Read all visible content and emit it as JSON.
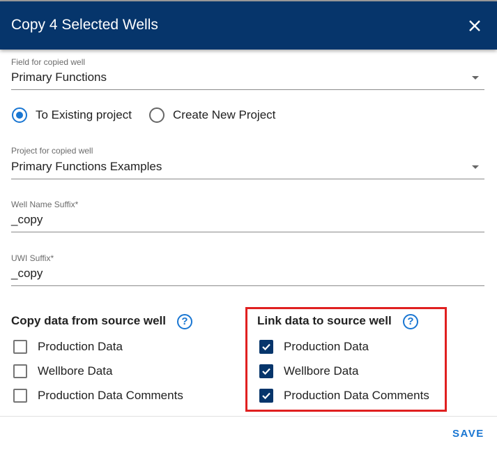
{
  "dialog": {
    "title": "Copy 4 Selected Wells",
    "close_icon": "close-icon"
  },
  "field_select": {
    "label": "Field for copied well",
    "value": "Primary Functions"
  },
  "destination": {
    "options": [
      {
        "label": "To Existing project",
        "selected": true
      },
      {
        "label": "Create New Project",
        "selected": false
      }
    ]
  },
  "project_select": {
    "label": "Project for copied well",
    "value": "Primary Functions Examples"
  },
  "well_name_suffix": {
    "label": "Well Name Suffix*",
    "value": "_copy"
  },
  "uwi_suffix": {
    "label": "UWI Suffix*",
    "value": "_copy"
  },
  "copy_section": {
    "title": "Copy data from source well",
    "help_icon": "help-circle-icon",
    "help_glyph": "?",
    "items": [
      {
        "label": "Production Data",
        "checked": false
      },
      {
        "label": "Wellbore Data",
        "checked": false
      },
      {
        "label": "Production Data Comments",
        "checked": false
      }
    ]
  },
  "link_section": {
    "title": "Link data to source well",
    "help_icon": "help-circle-icon",
    "help_glyph": "?",
    "items": [
      {
        "label": "Production Data",
        "checked": true
      },
      {
        "label": "Wellbore Data",
        "checked": true
      },
      {
        "label": "Production Data Comments",
        "checked": true
      }
    ]
  },
  "footer": {
    "save_label": "SAVE"
  },
  "colors": {
    "header_bg": "#06356b",
    "accent": "#1976d2",
    "highlight": "#e02020"
  }
}
